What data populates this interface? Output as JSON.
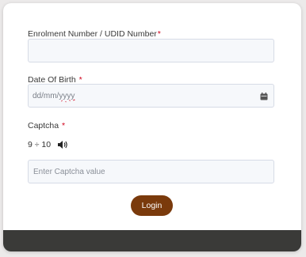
{
  "form": {
    "enrolment": {
      "label": "Enrolment Number / UDID Number",
      "required_mark": "*",
      "value": "",
      "placeholder": ""
    },
    "dob": {
      "label": "Date Of Birth",
      "required_mark": "*",
      "placeholder_prefix": "dd/mm/",
      "placeholder_year": "yyyy",
      "icon": "calendar-icon"
    },
    "captcha": {
      "label": "Captcha",
      "required_mark": "*",
      "question": "9 ÷ 10",
      "audio_icon": "speaker-icon",
      "input_placeholder": "Enter Captcha value",
      "input_value": ""
    },
    "login_label": "Login"
  },
  "colors": {
    "button_bg": "#7a3a0c",
    "required": "#d0021b",
    "footer": "#3a3a38"
  }
}
